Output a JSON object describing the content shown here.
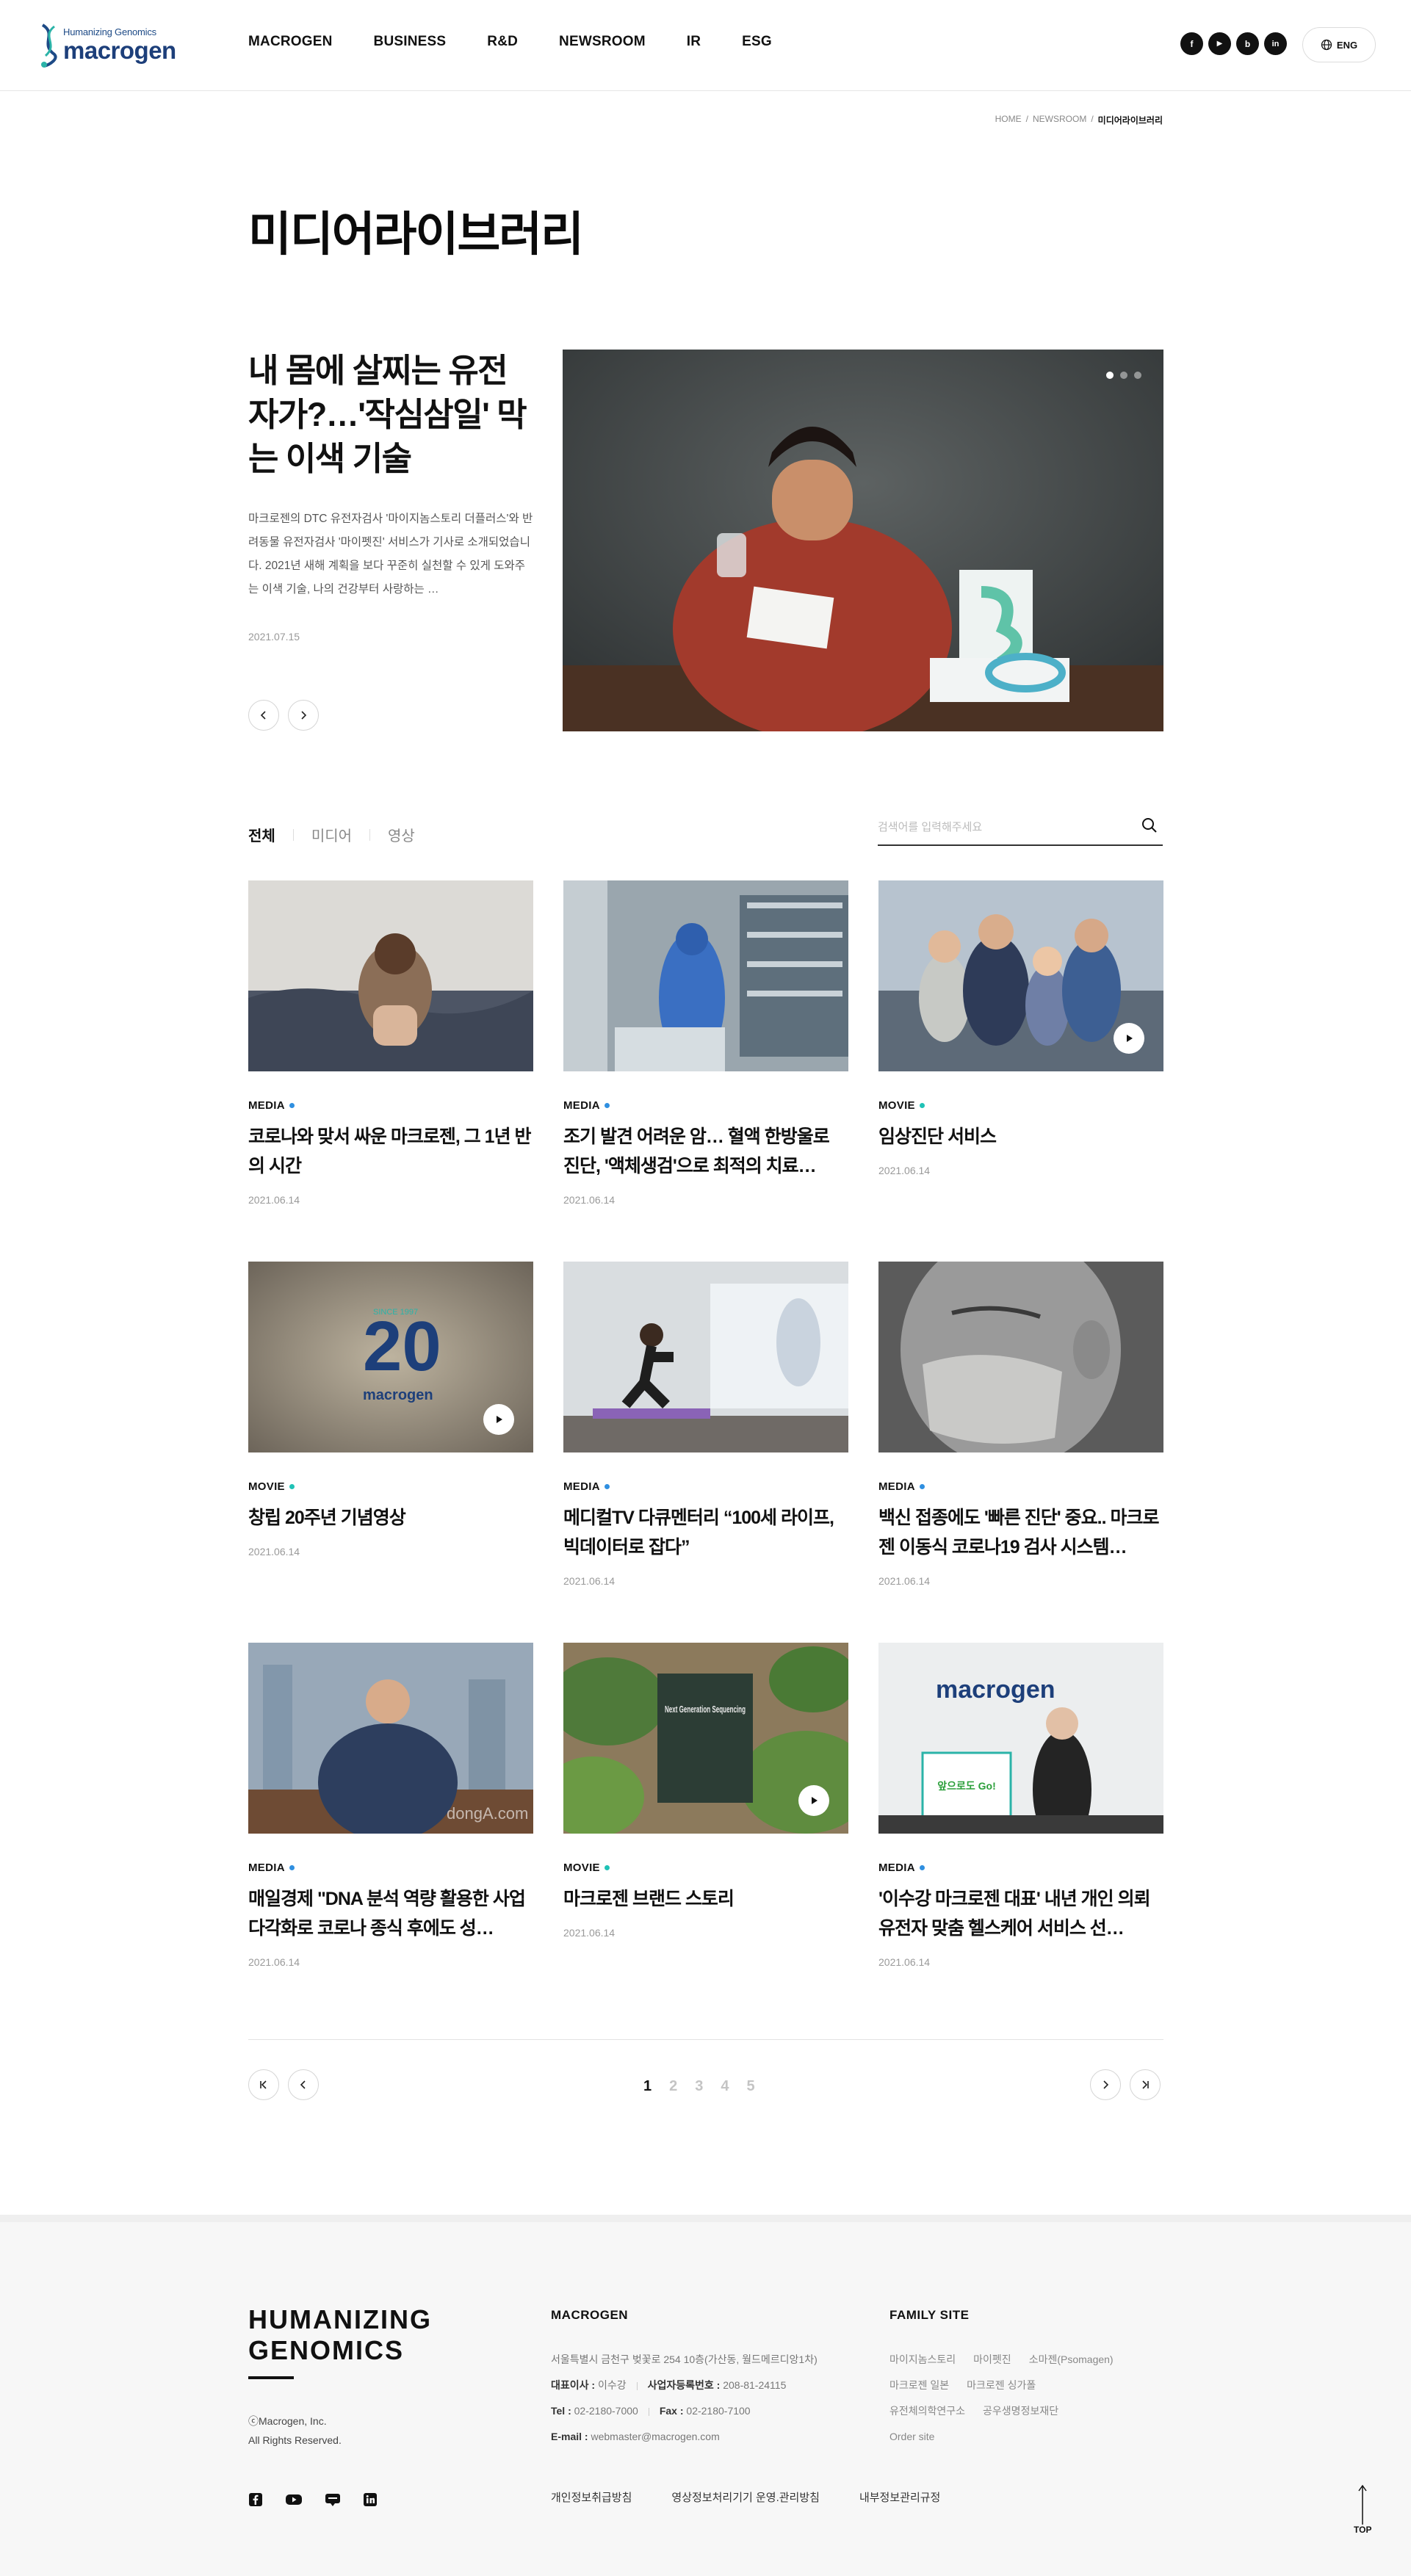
{
  "header": {
    "logo_tagline": "Humanizing Genomics",
    "logo_word": "macrogen",
    "nav": [
      "MACROGEN",
      "BUSINESS",
      "R&D",
      "NEWSROOM",
      "IR",
      "ESG"
    ],
    "sns": [
      {
        "icon": "facebook-icon",
        "glyph": "f"
      },
      {
        "icon": "youtube-icon",
        "glyph": "▶"
      },
      {
        "icon": "blog-icon",
        "glyph": "b"
      },
      {
        "icon": "linkedin-icon",
        "glyph": "in"
      }
    ],
    "lang_label": "ENG"
  },
  "breadcrumb": [
    "HOME",
    "NEWSROOM",
    "미디어라이브러리"
  ],
  "page_title": "미디어라이브러리",
  "feature": {
    "headline": "내 몸에 살찌는 유전자가?…'작심삼일' 막는 이색 기술",
    "summary": "마크로젠의 DTC 유전자검사 '마이지놈스토리 더플러스'와 반려동물 유전자검사 '마이펫진' 서비스가 기사로 소개되었습니다. 2021년 새해 계획을 보다 꾸준히 실천할 수 있게 도와주는 이색 기술, 나의 건강부터 사랑하는 …",
    "date": "2021.07.15"
  },
  "tabs": [
    "전체",
    "미디어",
    "영상"
  ],
  "search": {
    "placeholder": "검색어를 입력해주세요"
  },
  "colors": {
    "media": "#2f8fe0",
    "movie": "#1fc2b6",
    "brand_navy": "#1d3f7a"
  },
  "cards": [
    {
      "cat": "MEDIA",
      "title": "코로나와 맞서 싸운 마크로젠, 그 1년 반의 시간",
      "date": "2021.06.14"
    },
    {
      "cat": "MEDIA",
      "title": "조기 발견 어려운 암… 혈액 한방울로 진단, '액체생검'으로 최적의 치료…",
      "date": "2021.06.14"
    },
    {
      "cat": "MOVIE",
      "title": "임상진단 서비스",
      "date": "2021.06.14"
    },
    {
      "cat": "MOVIE",
      "title": "창립 20주년 기념영상",
      "date": "2021.06.14"
    },
    {
      "cat": "MEDIA",
      "title": "메디컬TV 다큐멘터리 “100세 라이프, 빅데이터로 잡다”",
      "date": "2021.06.14"
    },
    {
      "cat": "MEDIA",
      "title": "백신 접종에도 '빠른 진단' 중요.. 마크로젠 이동식 코로나19 검사 시스템…",
      "date": "2021.06.14"
    },
    {
      "cat": "MEDIA",
      "title": "매일경제 \"DNA 분석 역량 활용한 사업 다각화로 코로나 종식 후에도 성…",
      "date": "2021.06.14"
    },
    {
      "cat": "MOVIE",
      "title": "마크로젠 브랜드 스토리",
      "date": "2021.06.14"
    },
    {
      "cat": "MEDIA",
      "title": "'이수강 마크로젠 대표' 내년 개인 의뢰 유전자 맞춤 헬스케어 서비스 선…",
      "date": "2021.06.14"
    }
  ],
  "thumb_text": {
    "anniv_top": "SINCE 1997",
    "anniv_num": "20",
    "ngs": "Next Generation Sequencing",
    "dongA": "dongA.com",
    "banner": "앞으로도 Go!"
  },
  "pagination": {
    "pages": [
      "1",
      "2",
      "3",
      "4",
      "5"
    ],
    "current": "1"
  },
  "footer": {
    "brand_line1": "HUMANIZING",
    "brand_line2": "GENOMICS",
    "copy_line1": "ⓒMacrogen, Inc.",
    "copy_line2": "All Rights Reserved.",
    "col1_title": "MACROGEN",
    "address": "서울특별시 금천구 벚꽃로 254 10층(가산동, 월드메르디앙1차)",
    "ceo_label": "대표이사 :",
    "ceo": "이수강",
    "bizno_label": "사업자등록번호 :",
    "bizno": "208-81-24115",
    "tel_label": "Tel :",
    "tel": "02-2180-7000",
    "fax_label": "Fax :",
    "fax": "02-2180-7100",
    "email_label": "E-mail :",
    "email": "webmaster@macrogen.com",
    "col2_title": "FAMILY SITE",
    "family": [
      [
        "마이지놈스토리",
        "마이펫진",
        "소마젠(Psomagen)"
      ],
      [
        "마크로젠 일본",
        "마크로젠 싱가폴"
      ],
      [
        "유전체의학연구소",
        "공우생명정보재단"
      ],
      [
        "Order site"
      ]
    ],
    "links": [
      "개인정보취급방침",
      "영상정보처리기기 운영.관리방침",
      "내부정보관리규정"
    ],
    "top_label": "TOP"
  }
}
